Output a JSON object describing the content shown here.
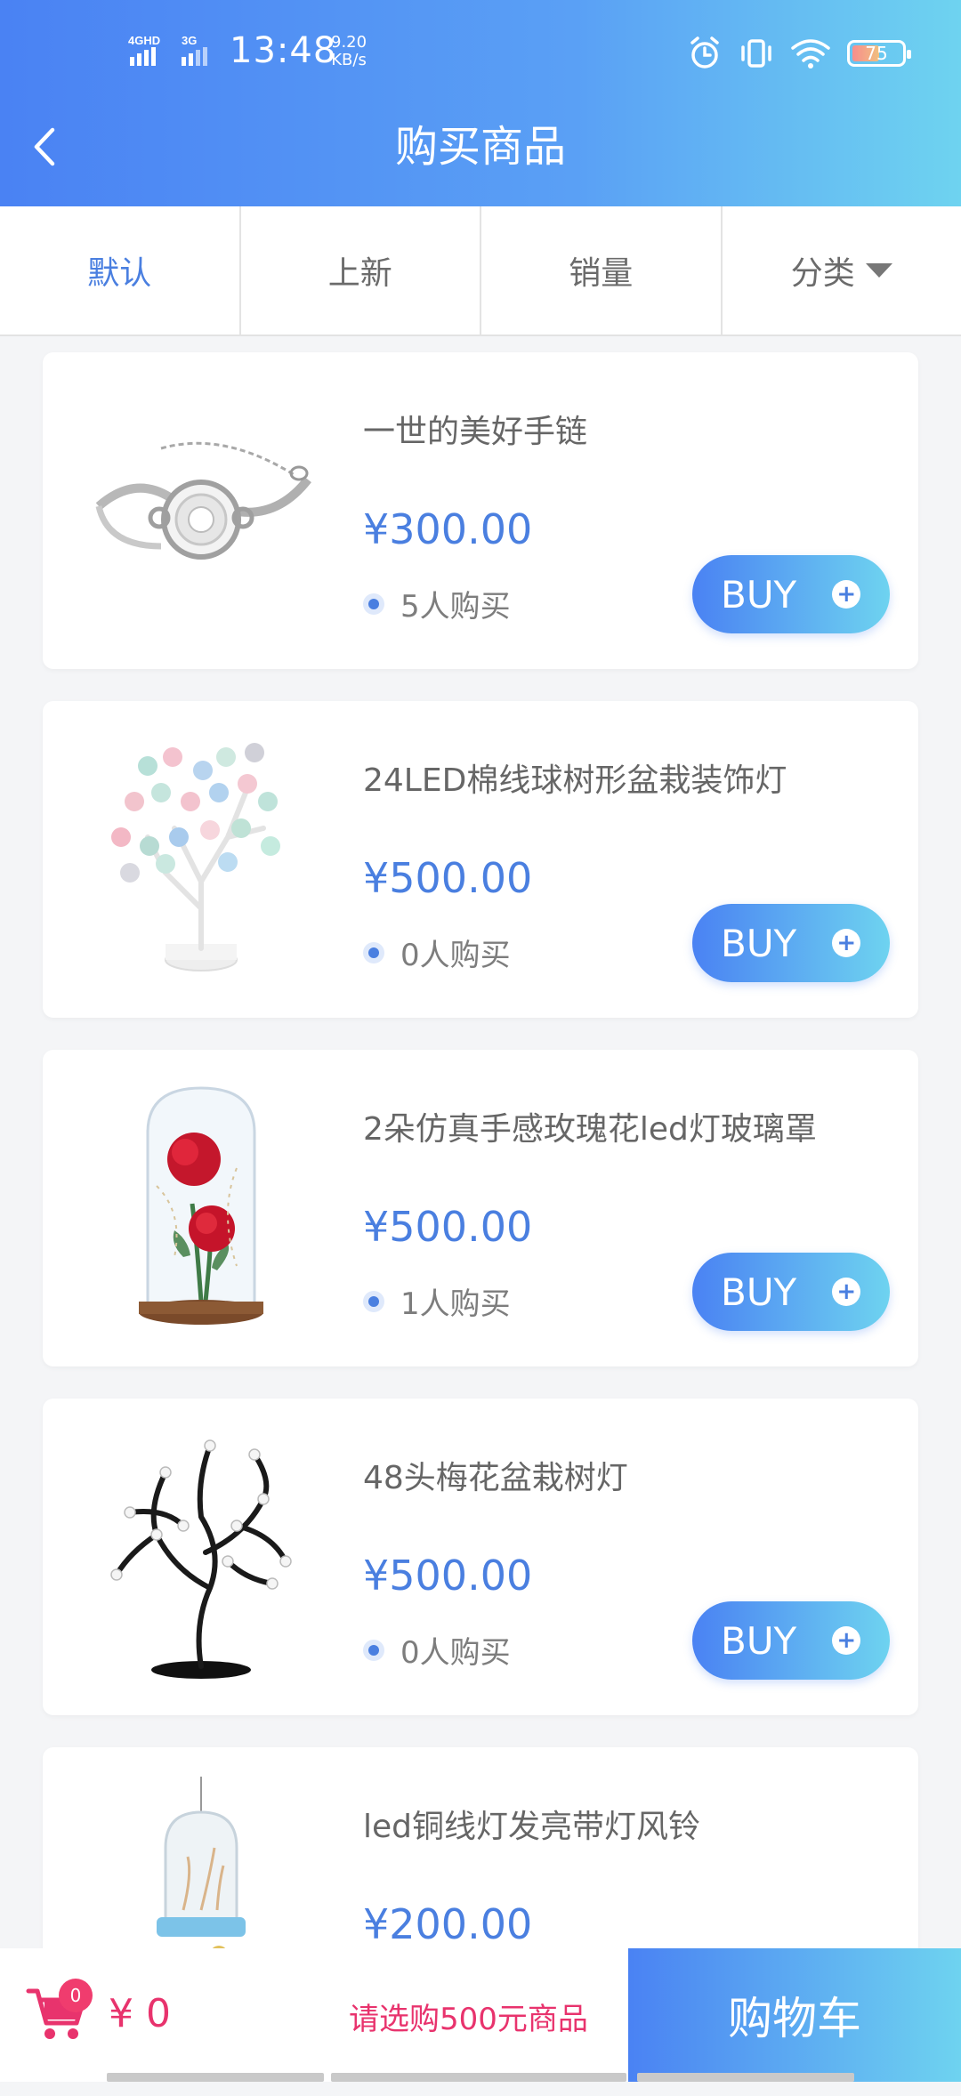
{
  "status_bar": {
    "network": "4GHD 3G",
    "time": "13:48",
    "speed_value": "9.20",
    "speed_unit": "KB/s",
    "battery": "75"
  },
  "header": {
    "title": "购买商品",
    "back_icon": "chevron-left-icon"
  },
  "tabs": [
    {
      "label": "默认",
      "active": true
    },
    {
      "label": "上新",
      "active": false
    },
    {
      "label": "销量",
      "active": false
    },
    {
      "label": "分类",
      "active": false,
      "icon": "triangle-down-icon"
    }
  ],
  "products": [
    {
      "name": "一世的美好手链",
      "price": "¥300.00",
      "bought": "5人购买",
      "buy_label": "BUY",
      "image": "bracelet"
    },
    {
      "name": "24LED棉线球树形盆栽装饰灯",
      "price": "¥500.00",
      "bought": "0人购买",
      "buy_label": "BUY",
      "image": "ball-tree-lamp"
    },
    {
      "name": "2朵仿真手感玫瑰花led灯玻璃罩",
      "price": "¥500.00",
      "bought": "1人购买",
      "buy_label": "BUY",
      "image": "rose-glass-dome"
    },
    {
      "name": "48头梅花盆栽树灯",
      "price": "¥500.00",
      "bought": "0人购买",
      "buy_label": "BUY",
      "image": "plum-tree-lamp"
    },
    {
      "name": "led铜线灯发亮带灯风铃",
      "price": "¥200.00",
      "bought": "",
      "buy_label": "",
      "image": "wind-chime"
    }
  ],
  "bottom_bar": {
    "cart_count": "0",
    "total": "¥ 0",
    "hint": "请选购500元商品",
    "cart_button": "购物车"
  },
  "colors": {
    "accent": "#4a7fe0",
    "gradient_start": "#4a82f3",
    "gradient_end": "#6ed3f0",
    "highlight": "#e8336d"
  }
}
